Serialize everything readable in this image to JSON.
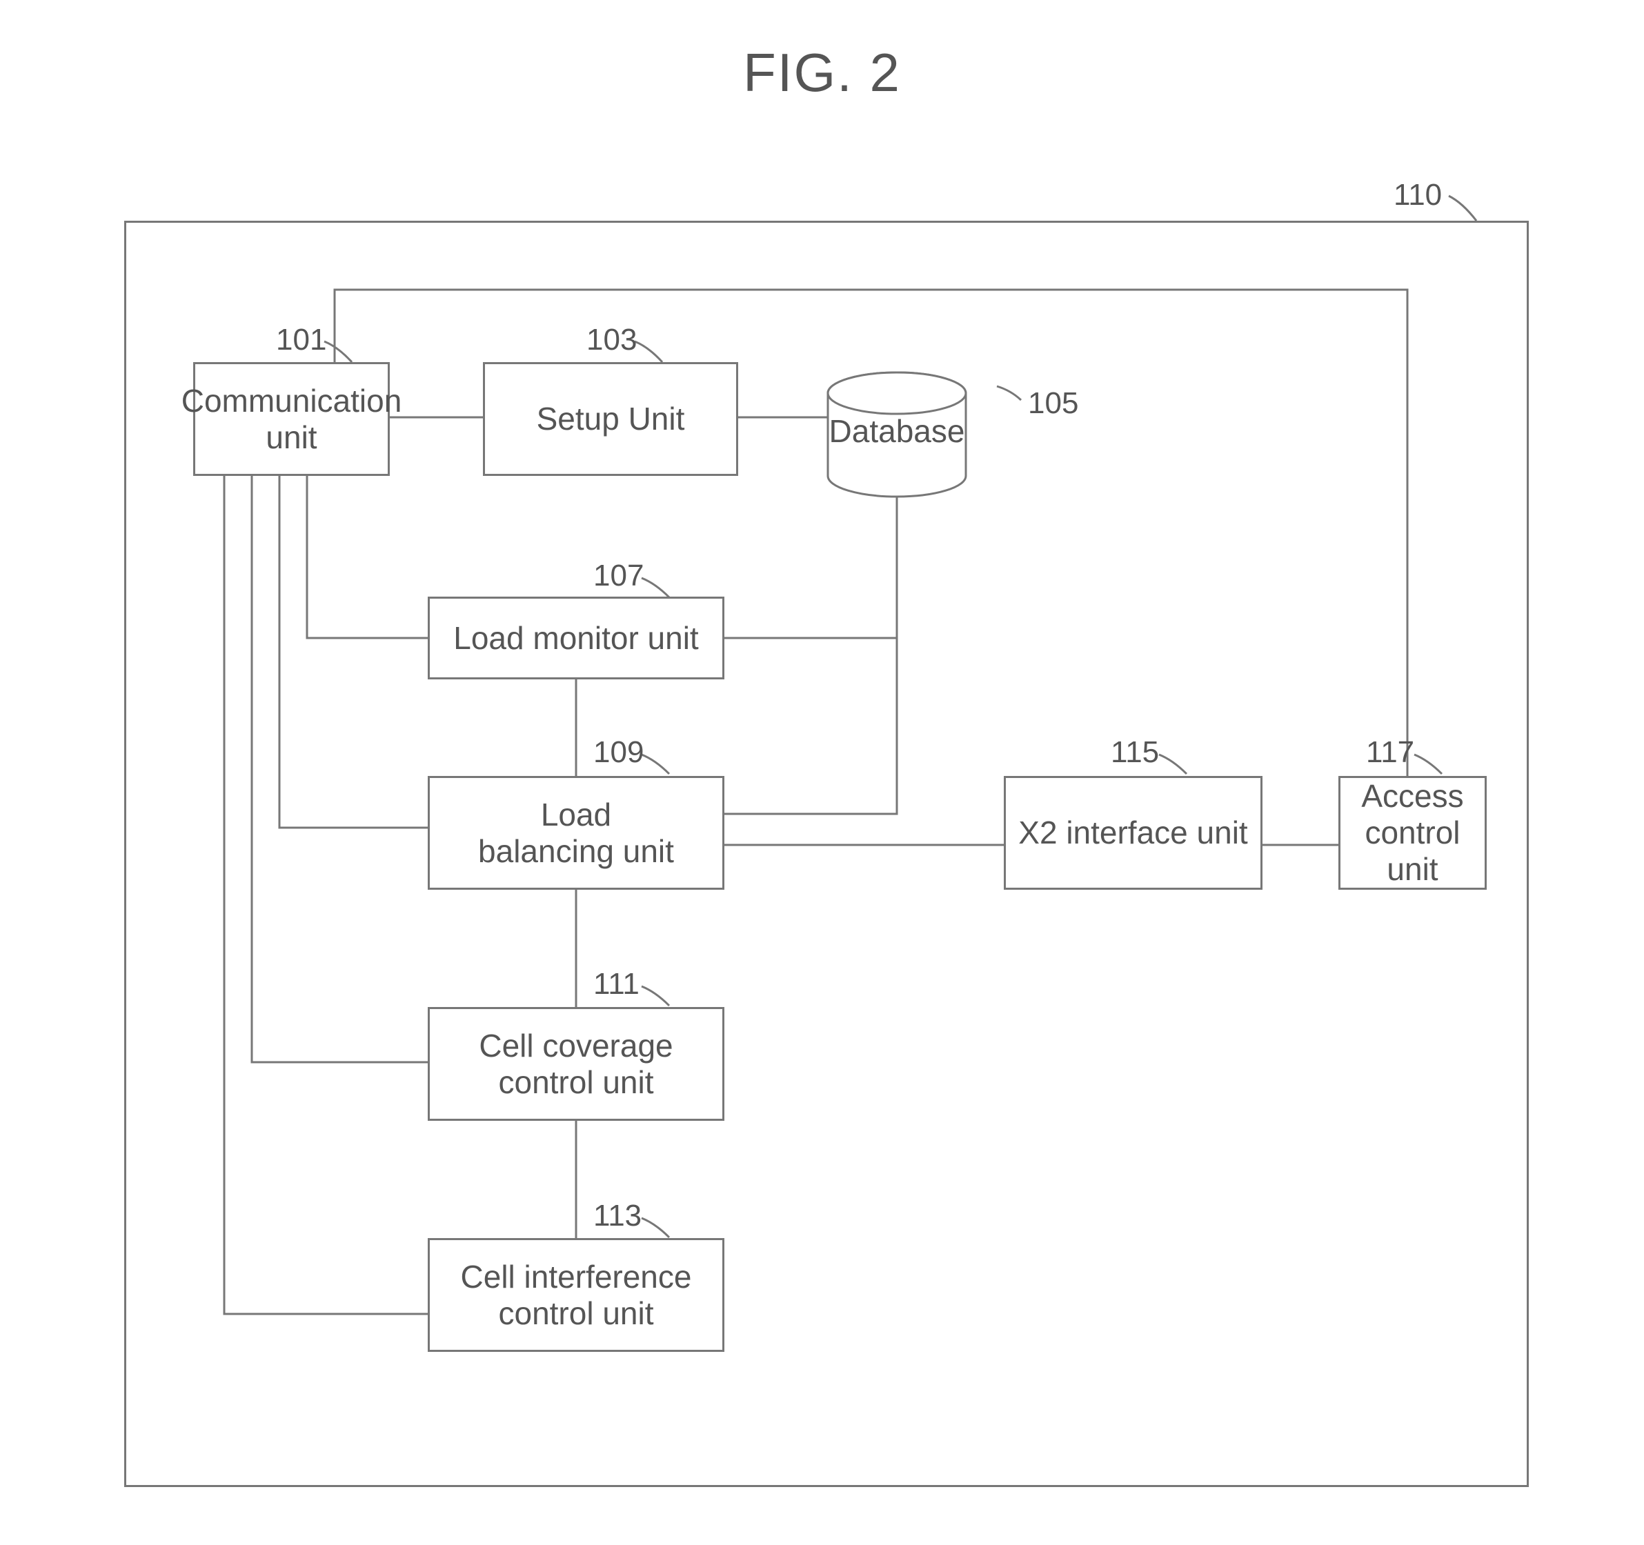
{
  "title": "FIG. 2",
  "container_ref": "110",
  "blocks": {
    "b101": {
      "label": "Communication\nunit",
      "ref": "101"
    },
    "b103": {
      "label": "Setup Unit",
      "ref": "103"
    },
    "b105": {
      "label": "Database",
      "ref": "105"
    },
    "b107": {
      "label": "Load monitor unit",
      "ref": "107"
    },
    "b109": {
      "label": "Load\nbalancing unit",
      "ref": "109"
    },
    "b111": {
      "label": "Cell coverage\ncontrol unit",
      "ref": "111"
    },
    "b113": {
      "label": "Cell interference\ncontrol unit",
      "ref": "113"
    },
    "b115": {
      "label": "X2 interface unit",
      "ref": "115"
    },
    "b117": {
      "label": "Access\ncontrol unit",
      "ref": "117"
    }
  }
}
